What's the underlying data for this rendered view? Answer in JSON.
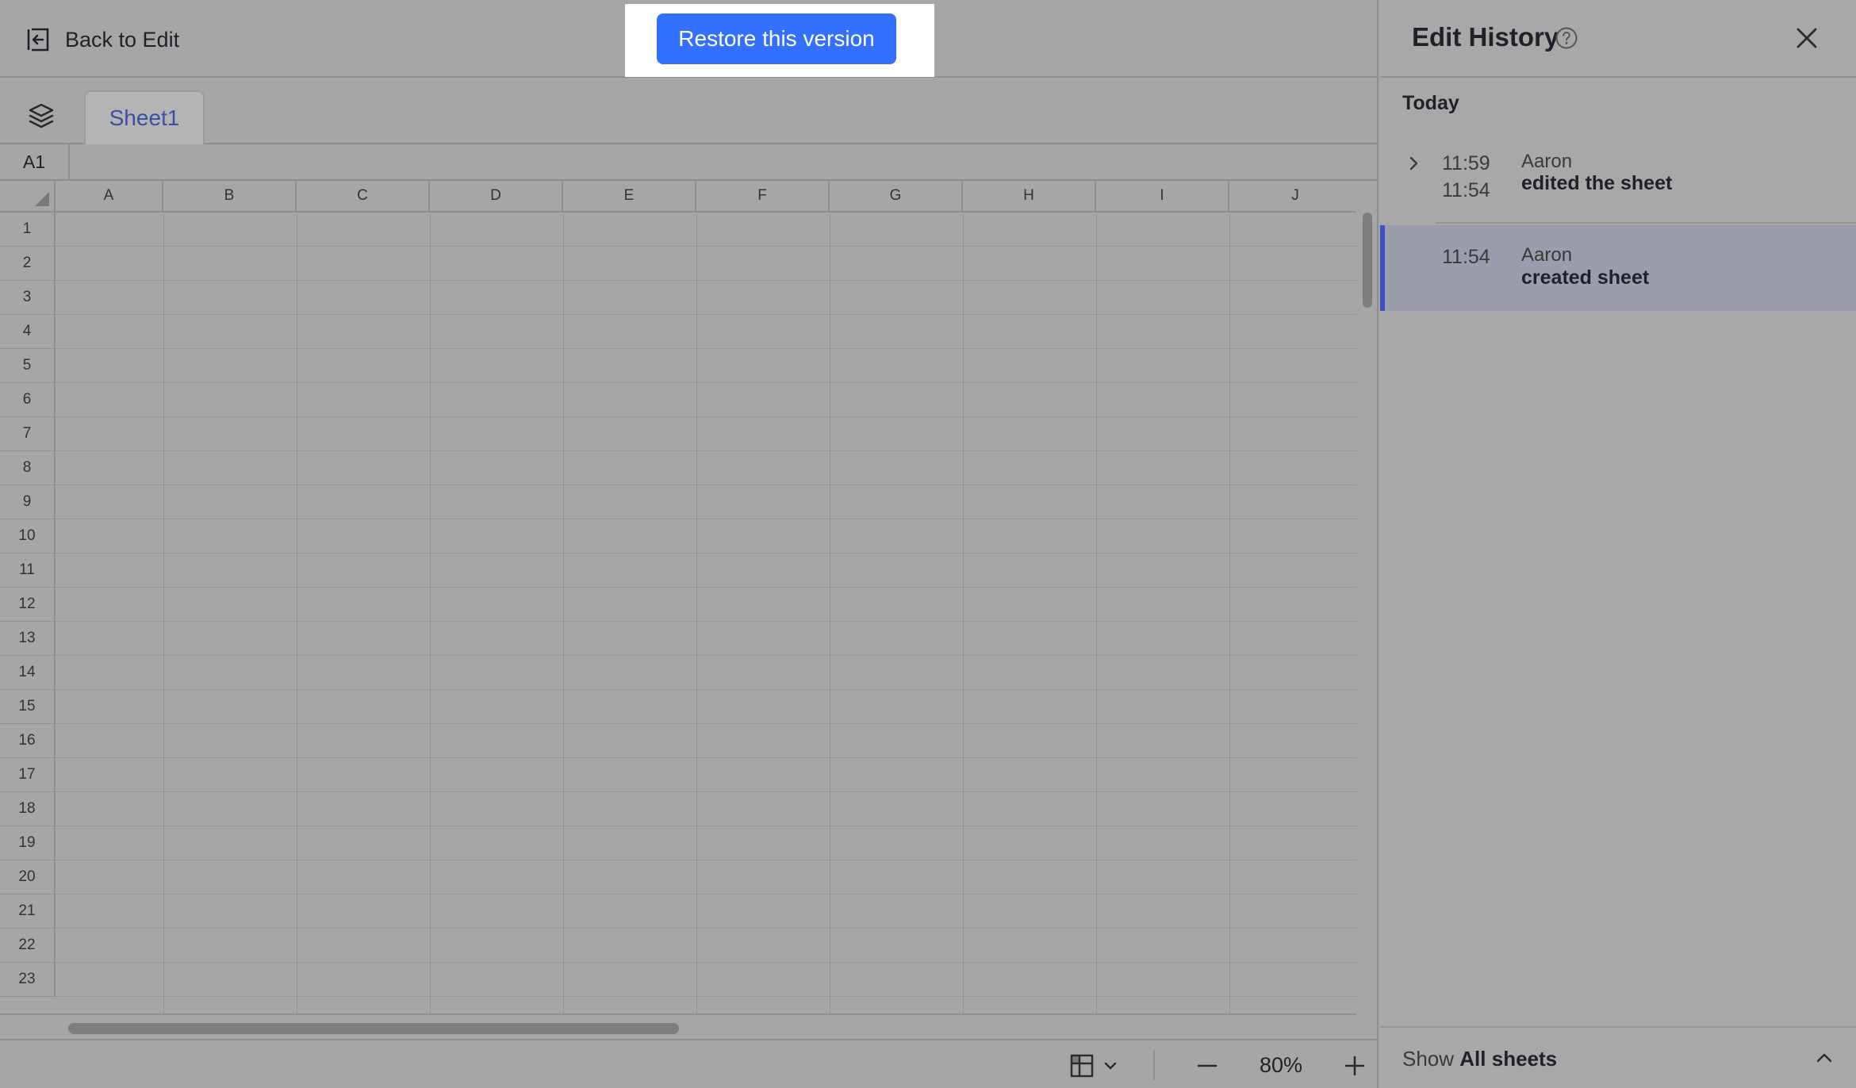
{
  "topbar": {
    "back_label": "Back to Edit",
    "restore_label": "Restore this version"
  },
  "sheet": {
    "tab_name": "Sheet1",
    "cell_ref": "A1",
    "columns": [
      "A",
      "B",
      "C",
      "D",
      "E",
      "F",
      "G",
      "H",
      "I",
      "J"
    ],
    "rows": [
      "1",
      "2",
      "3",
      "4",
      "5",
      "6",
      "7",
      "8",
      "9",
      "10",
      "11",
      "12",
      "13",
      "14",
      "15",
      "16",
      "17",
      "18",
      "19",
      "20",
      "21",
      "22",
      "23"
    ]
  },
  "status": {
    "zoom": "80%"
  },
  "panel": {
    "title": "Edit History",
    "group_label": "Today",
    "history": [
      {
        "time_start": "11:59",
        "time_end": "11:54",
        "user": "Aaron",
        "action": "edited the sheet",
        "selected": false
      },
      {
        "time_start": "11:54",
        "user": "Aaron",
        "action": "created sheet",
        "selected": true
      }
    ],
    "footer_prefix": "Show",
    "footer_value": "All sheets"
  },
  "colors": {
    "accent": "#3370ff",
    "selected_bar": "#3d52c4",
    "overlay_gray": "#a6a6a6"
  },
  "icons": [
    "back-icon",
    "layers-icon",
    "help-icon",
    "close-icon",
    "chevron-right-icon",
    "view-grid-icon",
    "chevron-down-icon",
    "minus-icon",
    "plus-icon",
    "chevron-up-icon"
  ]
}
